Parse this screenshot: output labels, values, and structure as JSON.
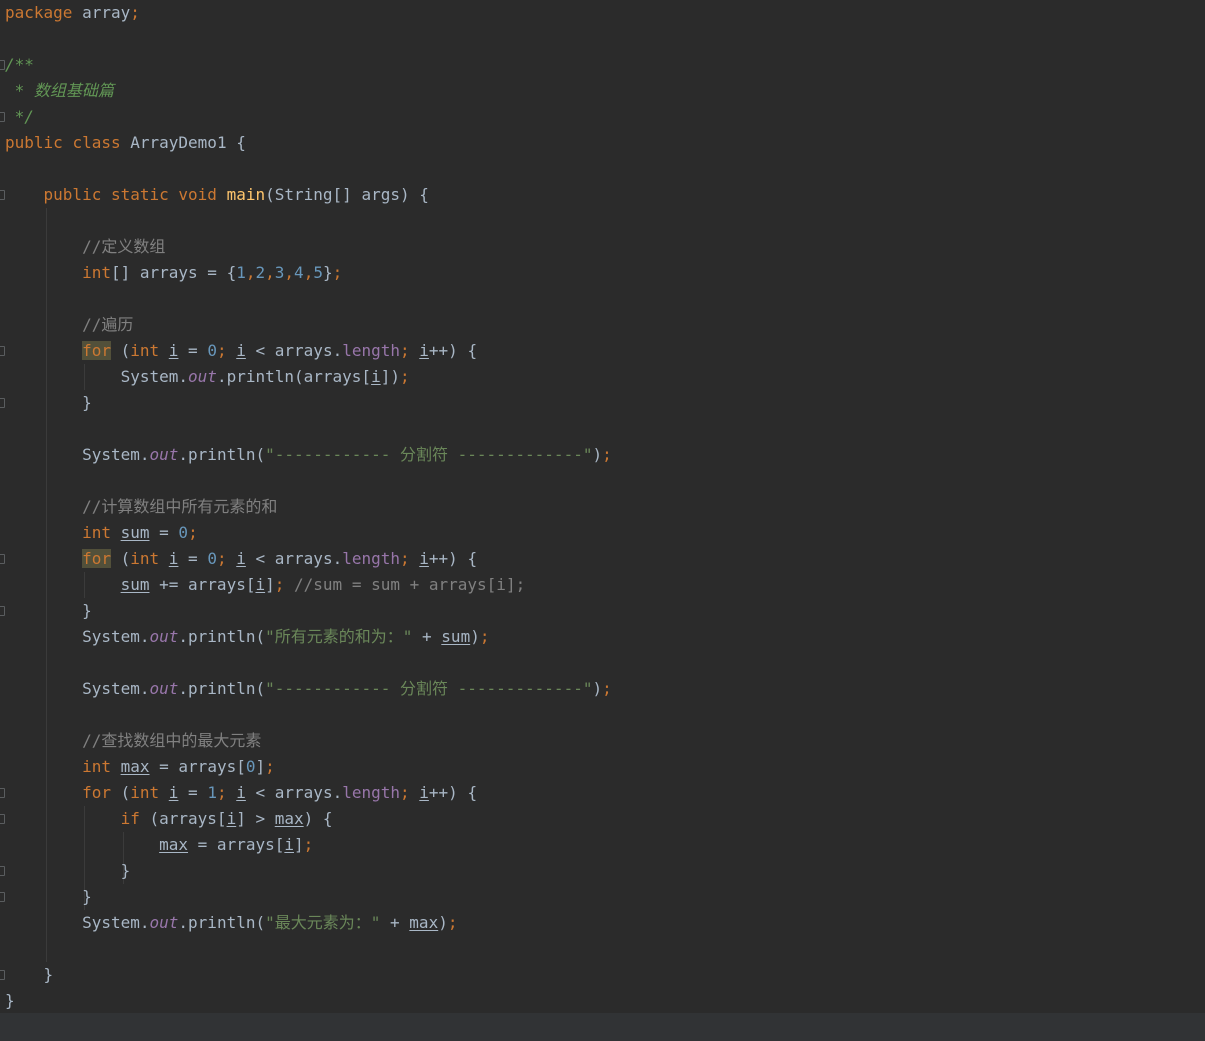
{
  "editor": {
    "language": "java",
    "colors": {
      "background": "#2b2b2b",
      "text": "#a9b7c6",
      "keyword": "#cc7832",
      "method": "#ffc66d",
      "number": "#6897bb",
      "string": "#6a8759",
      "comment": "#808080",
      "doc_comment": "#629755",
      "field": "#9876aa",
      "highlight": "#52503a",
      "bottom_bar": "#313335"
    },
    "lines": [
      {
        "fold": false,
        "tokens": [
          {
            "t": "package",
            "c": "kw"
          },
          {
            "t": " array"
          },
          {
            "t": ";",
            "c": "kw"
          }
        ]
      },
      {
        "fold": false,
        "tokens": []
      },
      {
        "fold": true,
        "tokens": [
          {
            "t": "/**",
            "c": "doc"
          }
        ]
      },
      {
        "fold": false,
        "tokens": [
          {
            "t": " * 数组基础篇",
            "c": "doc"
          }
        ]
      },
      {
        "fold": true,
        "tokens": [
          {
            "t": " */",
            "c": "doc"
          }
        ]
      },
      {
        "fold": false,
        "tokens": [
          {
            "t": "public",
            "c": "kw"
          },
          {
            "t": " "
          },
          {
            "t": "class",
            "c": "kw"
          },
          {
            "t": " ArrayDemo1 {"
          }
        ]
      },
      {
        "fold": false,
        "tokens": []
      },
      {
        "fold": true,
        "tokens": [
          {
            "t": "    "
          },
          {
            "t": "public",
            "c": "kw"
          },
          {
            "t": " "
          },
          {
            "t": "static",
            "c": "kw"
          },
          {
            "t": " "
          },
          {
            "t": "void",
            "c": "kw"
          },
          {
            "t": " "
          },
          {
            "t": "main",
            "c": "fn"
          },
          {
            "t": "(String[] args) {"
          }
        ]
      },
      {
        "fold": false,
        "tokens": []
      },
      {
        "fold": false,
        "tokens": [
          {
            "t": "        "
          },
          {
            "t": "//定义数组",
            "c": "cmt"
          }
        ]
      },
      {
        "fold": false,
        "tokens": [
          {
            "t": "        "
          },
          {
            "t": "int",
            "c": "kw"
          },
          {
            "t": "[] arrays = {"
          },
          {
            "t": "1",
            "c": "num"
          },
          {
            "t": ",",
            "c": "kw"
          },
          {
            "t": "2",
            "c": "num"
          },
          {
            "t": ",",
            "c": "kw"
          },
          {
            "t": "3",
            "c": "num"
          },
          {
            "t": ",",
            "c": "kw"
          },
          {
            "t": "4",
            "c": "num"
          },
          {
            "t": ",",
            "c": "kw"
          },
          {
            "t": "5",
            "c": "num"
          },
          {
            "t": "}"
          },
          {
            "t": ";",
            "c": "kw"
          }
        ]
      },
      {
        "fold": false,
        "tokens": []
      },
      {
        "fold": false,
        "tokens": [
          {
            "t": "        "
          },
          {
            "t": "//遍历",
            "c": "cmt"
          }
        ]
      },
      {
        "fold": true,
        "tokens": [
          {
            "t": "        "
          },
          {
            "t": "for",
            "c": "kw hl"
          },
          {
            "t": " ("
          },
          {
            "t": "int",
            "c": "kw"
          },
          {
            "t": " "
          },
          {
            "t": "i",
            "c": "var"
          },
          {
            "t": " = "
          },
          {
            "t": "0",
            "c": "num"
          },
          {
            "t": "; ",
            "c": "kw"
          },
          {
            "t": "i",
            "c": "var"
          },
          {
            "t": " < arrays."
          },
          {
            "t": "length",
            "c": "fld"
          },
          {
            "t": "; ",
            "c": "kw"
          },
          {
            "t": "i",
            "c": "var"
          },
          {
            "t": "++) {"
          }
        ]
      },
      {
        "fold": false,
        "tokens": [
          {
            "t": "            System."
          },
          {
            "t": "out",
            "c": "sfld"
          },
          {
            "t": ".println(arrays["
          },
          {
            "t": "i",
            "c": "var"
          },
          {
            "t": "])"
          },
          {
            "t": ";",
            "c": "kw"
          }
        ]
      },
      {
        "fold": true,
        "tokens": [
          {
            "t": "        }"
          }
        ]
      },
      {
        "fold": false,
        "tokens": []
      },
      {
        "fold": false,
        "tokens": [
          {
            "t": "        System."
          },
          {
            "t": "out",
            "c": "sfld"
          },
          {
            "t": ".println("
          },
          {
            "t": "\"------------ 分割符 -------------\"",
            "c": "str"
          },
          {
            "t": ")"
          },
          {
            "t": ";",
            "c": "kw"
          }
        ]
      },
      {
        "fold": false,
        "tokens": []
      },
      {
        "fold": false,
        "tokens": [
          {
            "t": "        "
          },
          {
            "t": "//计算数组中所有元素的和",
            "c": "cmt"
          }
        ]
      },
      {
        "fold": false,
        "tokens": [
          {
            "t": "        "
          },
          {
            "t": "int",
            "c": "kw"
          },
          {
            "t": " "
          },
          {
            "t": "sum",
            "c": "var"
          },
          {
            "t": " = "
          },
          {
            "t": "0",
            "c": "num"
          },
          {
            "t": ";",
            "c": "kw"
          }
        ]
      },
      {
        "fold": true,
        "tokens": [
          {
            "t": "        "
          },
          {
            "t": "for",
            "c": "kw hl"
          },
          {
            "t": " ("
          },
          {
            "t": "int",
            "c": "kw"
          },
          {
            "t": " "
          },
          {
            "t": "i",
            "c": "var"
          },
          {
            "t": " = "
          },
          {
            "t": "0",
            "c": "num"
          },
          {
            "t": "; ",
            "c": "kw"
          },
          {
            "t": "i",
            "c": "var"
          },
          {
            "t": " < arrays."
          },
          {
            "t": "length",
            "c": "fld"
          },
          {
            "t": "; ",
            "c": "kw"
          },
          {
            "t": "i",
            "c": "var"
          },
          {
            "t": "++) {"
          }
        ]
      },
      {
        "fold": false,
        "tokens": [
          {
            "t": "            "
          },
          {
            "t": "sum",
            "c": "var"
          },
          {
            "t": " += arrays["
          },
          {
            "t": "i",
            "c": "var"
          },
          {
            "t": "]"
          },
          {
            "t": "; ",
            "c": "kw"
          },
          {
            "t": "//sum = sum + arrays[i];",
            "c": "cmt"
          }
        ]
      },
      {
        "fold": true,
        "tokens": [
          {
            "t": "        }"
          }
        ]
      },
      {
        "fold": false,
        "tokens": [
          {
            "t": "        System."
          },
          {
            "t": "out",
            "c": "sfld"
          },
          {
            "t": ".println("
          },
          {
            "t": "\"所有元素的和为：\"",
            "c": "str"
          },
          {
            "t": " + "
          },
          {
            "t": "sum",
            "c": "var"
          },
          {
            "t": ")"
          },
          {
            "t": ";",
            "c": "kw"
          }
        ]
      },
      {
        "fold": false,
        "tokens": []
      },
      {
        "fold": false,
        "tokens": [
          {
            "t": "        System."
          },
          {
            "t": "out",
            "c": "sfld"
          },
          {
            "t": ".println("
          },
          {
            "t": "\"------------ 分割符 -------------\"",
            "c": "str"
          },
          {
            "t": ")"
          },
          {
            "t": ";",
            "c": "kw"
          }
        ]
      },
      {
        "fold": false,
        "tokens": []
      },
      {
        "fold": false,
        "tokens": [
          {
            "t": "        "
          },
          {
            "t": "//查找数组中的最大元素",
            "c": "cmt"
          }
        ]
      },
      {
        "fold": false,
        "tokens": [
          {
            "t": "        "
          },
          {
            "t": "int",
            "c": "kw"
          },
          {
            "t": " "
          },
          {
            "t": "max",
            "c": "var"
          },
          {
            "t": " = arrays["
          },
          {
            "t": "0",
            "c": "num"
          },
          {
            "t": "]"
          },
          {
            "t": ";",
            "c": "kw"
          }
        ]
      },
      {
        "fold": true,
        "tokens": [
          {
            "t": "        "
          },
          {
            "t": "for",
            "c": "kw"
          },
          {
            "t": " ("
          },
          {
            "t": "int",
            "c": "kw"
          },
          {
            "t": " "
          },
          {
            "t": "i",
            "c": "var"
          },
          {
            "t": " = "
          },
          {
            "t": "1",
            "c": "num"
          },
          {
            "t": "; ",
            "c": "kw"
          },
          {
            "t": "i",
            "c": "var"
          },
          {
            "t": " < arrays."
          },
          {
            "t": "length",
            "c": "fld"
          },
          {
            "t": "; ",
            "c": "kw"
          },
          {
            "t": "i",
            "c": "var"
          },
          {
            "t": "++) {"
          }
        ]
      },
      {
        "fold": true,
        "tokens": [
          {
            "t": "            "
          },
          {
            "t": "if",
            "c": "kw"
          },
          {
            "t": " (arrays["
          },
          {
            "t": "i",
            "c": "var"
          },
          {
            "t": "] > "
          },
          {
            "t": "max",
            "c": "var"
          },
          {
            "t": ") {"
          }
        ]
      },
      {
        "fold": false,
        "tokens": [
          {
            "t": "                "
          },
          {
            "t": "max",
            "c": "var"
          },
          {
            "t": " = arrays["
          },
          {
            "t": "i",
            "c": "var"
          },
          {
            "t": "]"
          },
          {
            "t": ";",
            "c": "kw"
          }
        ]
      },
      {
        "fold": true,
        "tokens": [
          {
            "t": "            }"
          }
        ]
      },
      {
        "fold": true,
        "tokens": [
          {
            "t": "        }"
          }
        ]
      },
      {
        "fold": false,
        "tokens": [
          {
            "t": "        System."
          },
          {
            "t": "out",
            "c": "sfld"
          },
          {
            "t": ".println("
          },
          {
            "t": "\"最大元素为：\"",
            "c": "str"
          },
          {
            "t": " + "
          },
          {
            "t": "max",
            "c": "var"
          },
          {
            "t": ")"
          },
          {
            "t": ";",
            "c": "kw"
          }
        ]
      },
      {
        "fold": false,
        "tokens": []
      },
      {
        "fold": true,
        "tokens": [
          {
            "t": "    }"
          }
        ]
      },
      {
        "fold": false,
        "tokens": [
          {
            "t": "}"
          }
        ]
      }
    ]
  }
}
